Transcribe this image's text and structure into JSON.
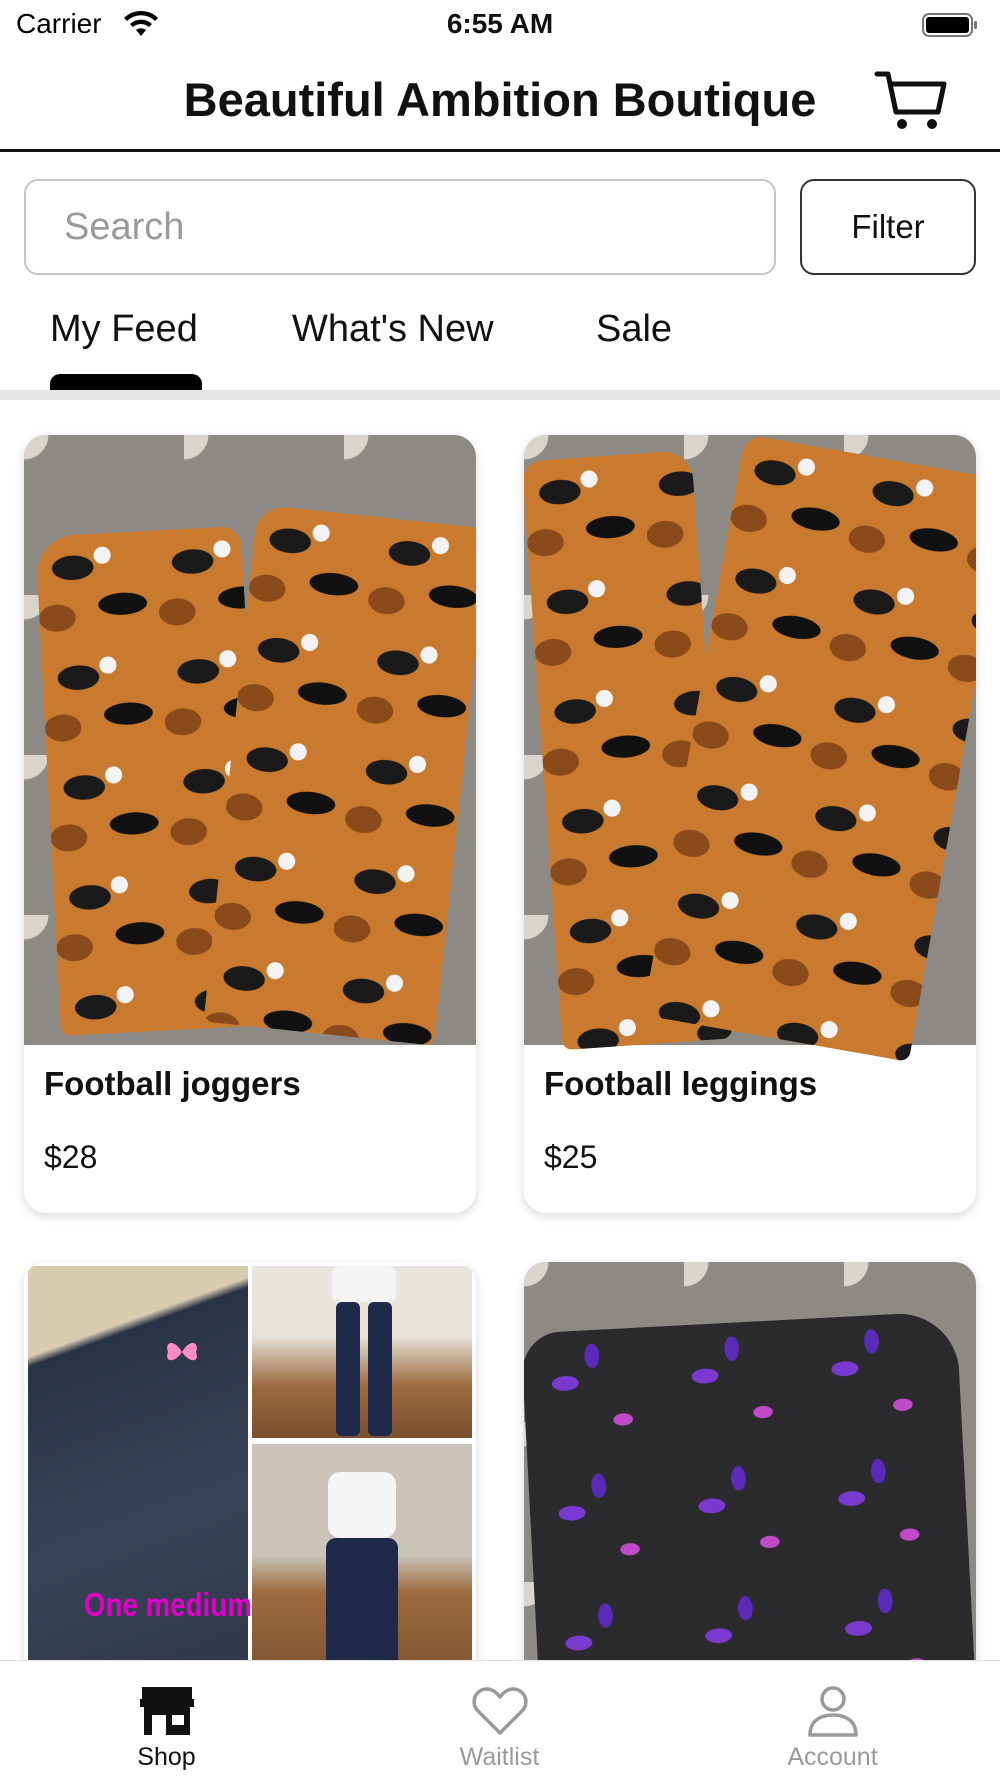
{
  "status_bar": {
    "carrier": "Carrier",
    "time": "6:55 AM"
  },
  "header": {
    "title": "Beautiful Ambition Boutique"
  },
  "search": {
    "placeholder": "Search",
    "value": "",
    "filter_label": "Filter"
  },
  "tabs": [
    {
      "label": "My Feed",
      "active": true
    },
    {
      "label": "What's New",
      "active": false
    },
    {
      "label": "Sale",
      "active": false
    }
  ],
  "products": [
    {
      "name": "Football joggers",
      "price": "$28"
    },
    {
      "name": "Football leggings",
      "price": "$25"
    },
    {
      "overlay_text": "One medium"
    },
    {}
  ],
  "tab_bar": [
    {
      "label": "Shop",
      "icon": "shop-icon",
      "active": true
    },
    {
      "label": "Waitlist",
      "icon": "heart-icon",
      "active": false
    },
    {
      "label": "Account",
      "icon": "person-icon",
      "active": false
    }
  ],
  "colors": {
    "active": "#111111",
    "inactive": "#9a9a9a",
    "accent_text": "#e000c8"
  }
}
